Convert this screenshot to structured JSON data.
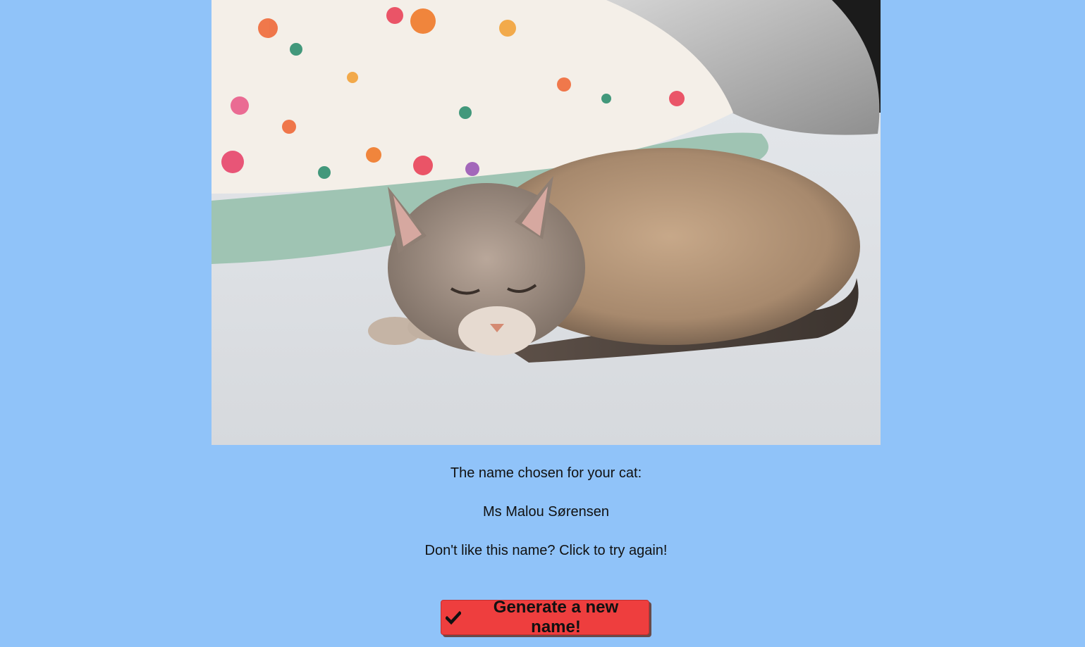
{
  "photo": {
    "icon": "sleeping-cat-photo"
  },
  "result": {
    "label": "The name chosen for your cat:",
    "name": "Ms Malou Sørensen",
    "retry_text": "Don't like this name? Click to try again!"
  },
  "button": {
    "label": "Generate a new name!",
    "icon": "check-icon",
    "color": "#ee3e3e"
  },
  "colors": {
    "background": "#90c3f9"
  }
}
